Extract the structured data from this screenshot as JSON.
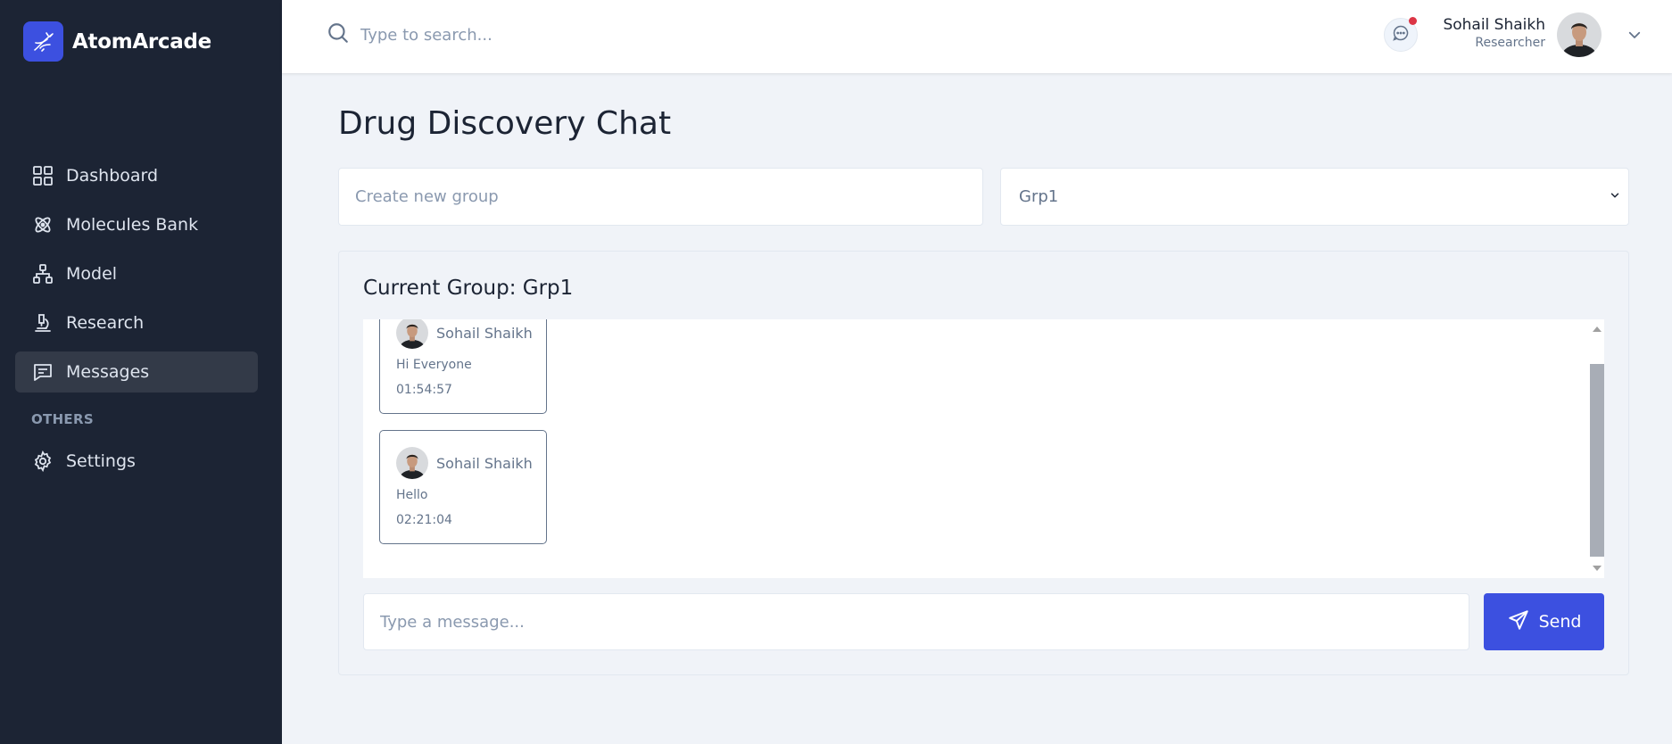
{
  "brand": {
    "name": "AtomArcade"
  },
  "sidebar": {
    "items": [
      {
        "label": "Dashboard",
        "icon": "grid-icon"
      },
      {
        "label": "Molecules Bank",
        "icon": "atom-icon"
      },
      {
        "label": "Model",
        "icon": "hierarchy-icon"
      },
      {
        "label": "Research",
        "icon": "microscope-icon"
      },
      {
        "label": "Messages",
        "icon": "message-icon",
        "active": true
      }
    ],
    "section_label": "OTHERS",
    "other_items": [
      {
        "label": "Settings",
        "icon": "gear-icon"
      }
    ]
  },
  "header": {
    "search_placeholder": "Type to search...",
    "user_name": "Sohail Shaikh",
    "user_role": "Researcher"
  },
  "main": {
    "title": "Drug Discovery Chat",
    "new_group_placeholder": "Create new group",
    "group_select_value": "Grp1",
    "panel_title": "Current Group: Grp1",
    "messages": [
      {
        "sender": "Sohail Shaikh",
        "text": "Hi Everyone",
        "time": "01:54:57"
      },
      {
        "sender": "Sohail Shaikh",
        "text": "Hello",
        "time": "02:21:04"
      }
    ],
    "message_placeholder": "Type a message...",
    "send_label": "Send"
  },
  "colors": {
    "sidebar_bg": "#1c2434",
    "primary": "#3c50e0",
    "page_bg": "#f0f3f8",
    "notification": "#dc3545"
  }
}
